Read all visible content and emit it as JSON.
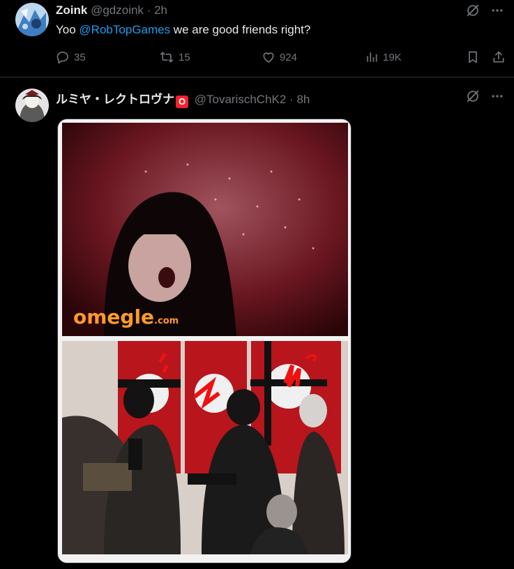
{
  "tweets": [
    {
      "name": "Zoink",
      "handle": "@gdzoink",
      "dot": "·",
      "time": "2h",
      "text_before": "Yoo ",
      "mention": "@RobTopGames",
      "text_after": " we are good friends right?",
      "replies": "35",
      "reposts": "15",
      "likes": "924",
      "views": "19K"
    },
    {
      "name": "ルミヤ・レクトロヴナ",
      "badge": "O",
      "handle": "@TovarischChK2",
      "dot": "·",
      "time": "8h",
      "media": {
        "watermark": "omegle",
        "watermark_suffix": ".com"
      }
    }
  ],
  "icons": {
    "grok": "grok-icon",
    "more": "more-icon",
    "reply": "reply-icon",
    "repost": "repost-icon",
    "like": "like-icon",
    "views": "views-icon",
    "bookmark": "bookmark-icon",
    "share": "share-icon"
  },
  "colors": {
    "background": "#000000",
    "text": "#e7e9ea",
    "secondary": "#71767b",
    "link": "#1d9bf0",
    "badge": "#f4212e"
  }
}
